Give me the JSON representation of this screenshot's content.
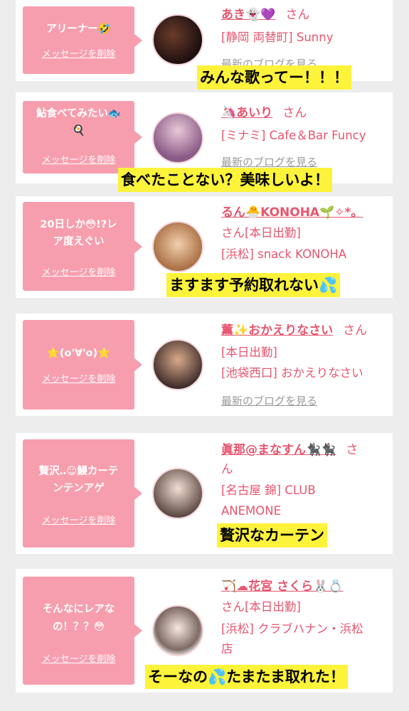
{
  "cards": [
    {
      "bubble_lines": [
        "アリーナー🤣"
      ],
      "delete_label": "メッセージを削除",
      "name": "あき👻💜",
      "san": "さん",
      "info": [
        "[静岡 両替町] Sunny"
      ],
      "blog": "最新のブログを見る",
      "caption": "みんな歌ってー！！！"
    },
    {
      "bubble_lines": [
        "鮎食べてみたい🐟",
        "🍳"
      ],
      "delete_label": "メッセージを削除",
      "name": "🦄あいり",
      "san": "さん",
      "info": [
        "[ミナミ] Cafe＆Bar Funcy"
      ],
      "blog": "最新のブログを見る",
      "caption": "食べたことない？美味しいよ！"
    },
    {
      "bubble_lines": [
        "20日しか😳!?レ",
        "ア度えぐい"
      ],
      "delete_label": "メッセージを削除",
      "name": "るん🐣KONOHA🌱✧*。",
      "san": "さん[本日出勤]",
      "info": [
        "[浜松] snack KONOHA"
      ],
      "caption": "ますます予約取れない💦"
    },
    {
      "bubble_lines": [
        "⭐(o'∀'o)⭐"
      ],
      "delete_label": "メッセージを削除",
      "name": "薫✨おかえりなさい",
      "san": "さん",
      "info": [
        "[本日出勤]",
        "[池袋西口] おかえりなさい"
      ],
      "blog": "最新のブログを見る"
    },
    {
      "bubble_lines": [
        "贅沢‥☺鰻カーテ",
        "ンテンアゲ"
      ],
      "delete_label": "メッセージを削除",
      "name": "眞那@まなすん🐈‍⬛🐈‍⬛",
      "san": "さ",
      "san2": "ん",
      "info": [
        "[名古屋 錦] CLUB",
        "ANEMONE"
      ],
      "caption": "贅沢なカーテン"
    },
    {
      "bubble_lines": [
        "そんなにレアな",
        "の！？？😳"
      ],
      "delete_label": "メッセージを削除",
      "name": "🏹☁花宮 さくら🐰💍",
      "san": "さん[本日出勤]",
      "info": [
        "[浜松] クラブハナン・浜松",
        "店"
      ],
      "caption": "そーなの💦たまたま取れた！"
    }
  ]
}
